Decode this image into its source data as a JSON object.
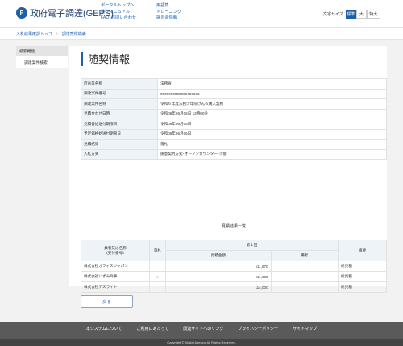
{
  "header": {
    "logo_mark": "P",
    "logo_text": "政府電子調達(GEPS)",
    "links_col1": [
      "ポータルトップへ",
      "操作マニュアル",
      "FAQ･お問い合わせ"
    ],
    "links_col2": [
      "用語集",
      "トレーニング",
      "講習会情報"
    ],
    "font_size_label": "文字サイズ",
    "font_sizes": [
      "標準",
      "大",
      "特大"
    ],
    "active_font_size": "標準"
  },
  "breadcrumb": [
    "入札結果確認トップ",
    "調達案件検索"
  ],
  "sidebar": {
    "title": "検索機能",
    "items": [
      "調達案件検索"
    ]
  },
  "main": {
    "title": "随契情報",
    "info_rows": [
      {
        "label": "府省等名称",
        "value": "法務省"
      },
      {
        "label": "調達案件番号",
        "value": "0000000000000459933"
      },
      {
        "label": "調達案件名称",
        "value": "令和６年度法務少年院けん衣購入契約"
      },
      {
        "label": "見積合わせ日時",
        "value": "令和06年06月06日 13時00分"
      },
      {
        "label": "見積書始送付期限日",
        "value": "令和06年06月06日"
      },
      {
        "label": "予定価格始送付期限日",
        "value": "令和06年06月06日"
      },
      {
        "label": "見積結果",
        "value": "落札"
      },
      {
        "label": "入札方式",
        "value": "随意契約方式･オープンカウンター･少額"
      }
    ],
    "result_title": "見積結果一覧",
    "result_headers": {
      "company": "業者又は名称\n(受付番号)",
      "winner": "落札",
      "round": "第１回",
      "amount": "見積金額",
      "remarks_sub": "備考",
      "notes": "摘要"
    },
    "result_rows": [
      {
        "company": "株式会社オフィスジャパン",
        "winner": "",
        "amount": "\\11,670",
        "remarks": "",
        "notes": "総見積"
      },
      {
        "company": "株式会社いずみ商事",
        "winner": "○",
        "amount": "\\11,600",
        "remarks": "",
        "notes": "総見積"
      },
      {
        "company": "株式会社アスライト",
        "winner": "",
        "amount": "\\14,000",
        "remarks": "",
        "notes": "総見積"
      }
    ],
    "back_label": "戻る"
  },
  "footer": {
    "links": [
      "本システムについて",
      "ご利用にあたって",
      "関連サイトへのリンク",
      "プライバシーポリシー",
      "サイトマップ"
    ],
    "copyright": "Copyright © Digital Agency. All Rights Reserved."
  }
}
